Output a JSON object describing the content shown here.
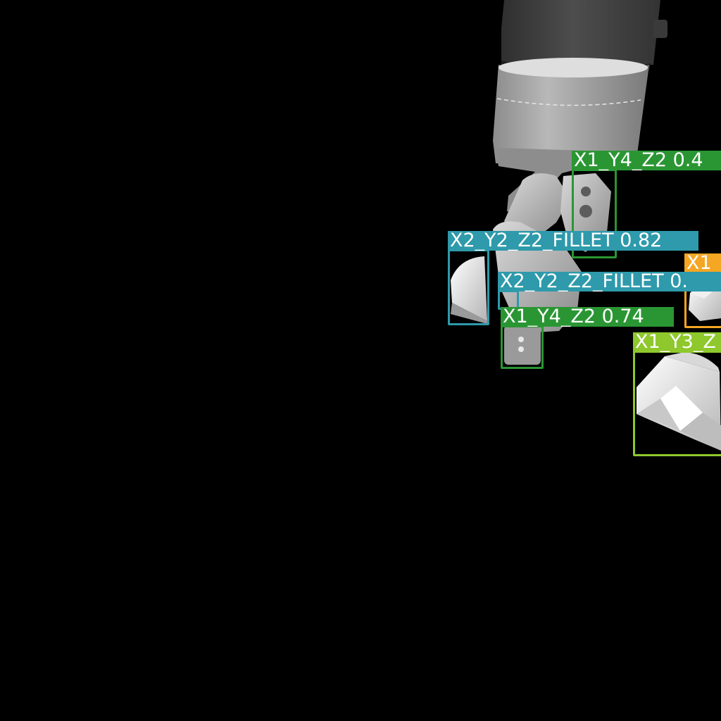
{
  "scene": {
    "background": "#000000",
    "object": "robot-gripper-with-parts"
  },
  "detections": [
    {
      "label": "X1_Y4_Z2 0.4",
      "color": "#2a9633"
    },
    {
      "label": "X2_Y2_Z2_FILLET 0.82",
      "color": "#2e9aab"
    },
    {
      "label": "X1_",
      "color": "#f5a623"
    },
    {
      "label": "X2_Y2_Z2_FILLET 0.",
      "color": "#2e9aab"
    },
    {
      "label": "X1_Y4_Z2 0.74",
      "color": "#2a9633"
    },
    {
      "label": "X1_Y3_Z",
      "color": "#8ec82c"
    }
  ]
}
